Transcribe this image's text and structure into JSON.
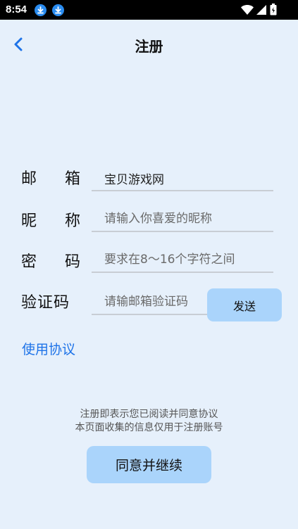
{
  "status_bar": {
    "time": "8:54",
    "icons": [
      "download-icon",
      "download-icon",
      "wifi-icon",
      "signal-icon",
      "battery-icon"
    ]
  },
  "header": {
    "title": "注册",
    "back_icon": "chevron-left-icon"
  },
  "form": {
    "email": {
      "label_chars": [
        "邮",
        "箱"
      ],
      "value": "宝贝游戏网",
      "placeholder": ""
    },
    "nickname": {
      "label_chars": [
        "昵",
        "称"
      ],
      "value": "",
      "placeholder": "请输入你喜爱的昵称"
    },
    "password": {
      "label_chars": [
        "密",
        "码"
      ],
      "value": "",
      "placeholder": "要求在8～16个字符之间"
    },
    "code": {
      "label": "验证码",
      "value": "",
      "placeholder": "请输邮箱验证码"
    },
    "send_label": "发送"
  },
  "agreement_link": "使用协议",
  "notice": {
    "line1": "注册即表示您已阅读并同意协议",
    "line2": "本页面收集的信息仅用于注册账号"
  },
  "continue_label": "同意并继续",
  "colors": {
    "background": "#e6f0fb",
    "button": "#aad4fb",
    "link": "#1e73e8"
  }
}
